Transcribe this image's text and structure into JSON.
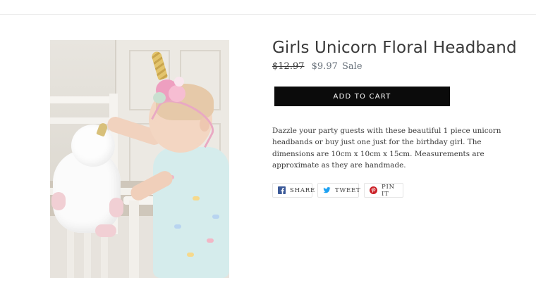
{
  "product": {
    "title": "Girls Unicorn Floral Headband",
    "price_regular": "$12.97",
    "price_sale": "$9.97",
    "sale_label": "Sale",
    "add_to_cart_label": "ADD TO CART",
    "description": "Dazzle your party guests with these beautiful 1 piece unicorn headbands or buy just one just for the birthday girl.  The dimensions are 10cm x 10cm x 15cm.  Measurements are approximate as they are handmade."
  },
  "social": {
    "share_label": "SHARE",
    "tweet_label": "TWEET",
    "pin_label": "PIN IT",
    "share_icon": "facebook-icon",
    "tweet_icon": "twitter-icon",
    "pin_icon": "pinterest-icon"
  },
  "colors": {
    "button_bg": "#0b0b0b",
    "sale_price": "#69727b",
    "facebook": "#3b5998",
    "twitter": "#1da1f2",
    "pinterest": "#cb2027"
  }
}
